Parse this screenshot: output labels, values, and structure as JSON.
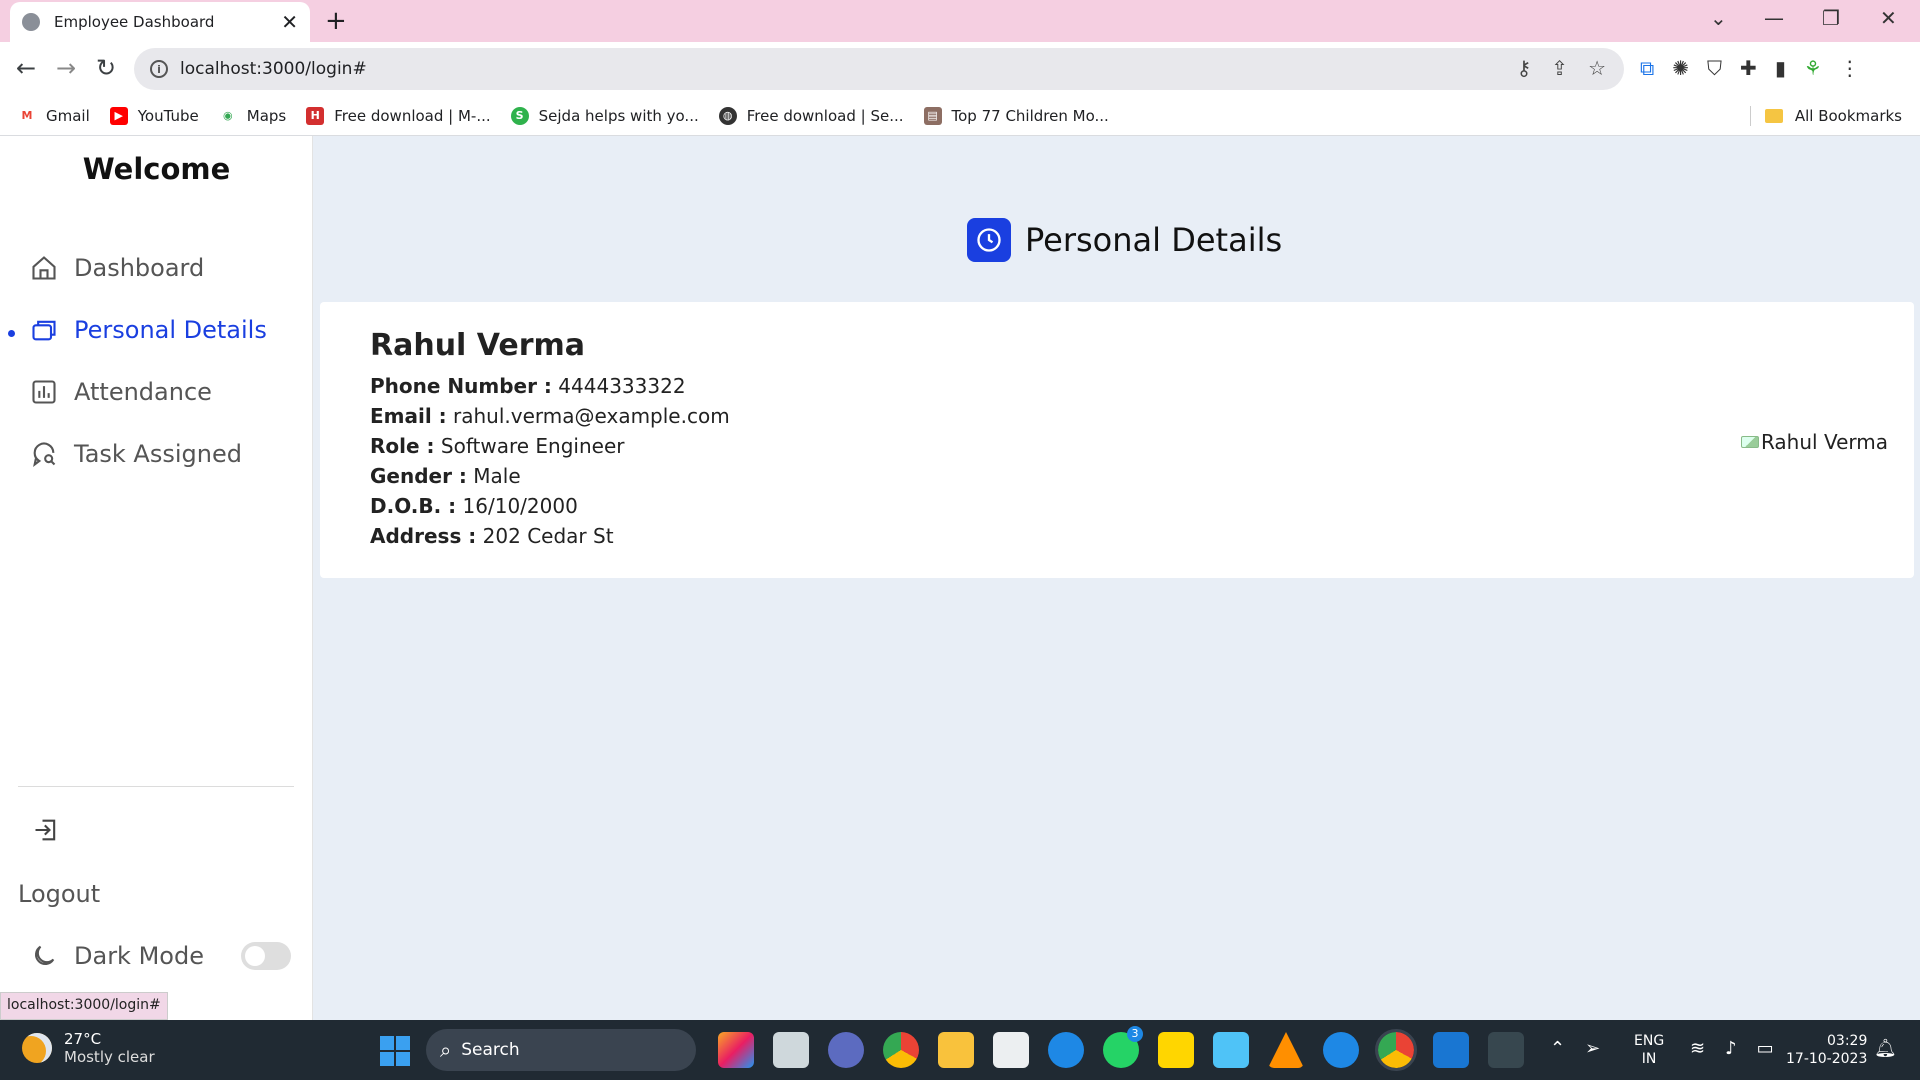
{
  "browser": {
    "tab_title": "Employee Dashboard",
    "url": "localhost:3000/login#",
    "bookmarks": [
      {
        "label": "Gmail",
        "color": "#ea4335",
        "glyph": "M"
      },
      {
        "label": "YouTube",
        "color": "#ff0000",
        "glyph": "▶"
      },
      {
        "label": "Maps",
        "color": "#34a853",
        "glyph": "◉"
      },
      {
        "label": "Free download | M-...",
        "color": "#d32f2f",
        "glyph": "H"
      },
      {
        "label": "Sejda helps with yo...",
        "color": "#2fb24c",
        "glyph": "S"
      },
      {
        "label": "Free download | Se...",
        "color": "#333333",
        "glyph": "◍"
      },
      {
        "label": "Top 77 Children Mo...",
        "color": "#8d6e63",
        "glyph": "▤"
      }
    ],
    "all_bookmarks": "All Bookmarks",
    "status_url": "localhost:3000/login#"
  },
  "sidebar": {
    "welcome": "Welcome",
    "items": [
      {
        "label": "Dashboard",
        "icon": "home-icon"
      },
      {
        "label": "Personal Details",
        "icon": "cards-icon"
      },
      {
        "label": "Attendance",
        "icon": "chart-icon"
      },
      {
        "label": "Task Assigned",
        "icon": "chat-search-icon"
      }
    ],
    "logout": "Logout",
    "dark_mode": "Dark Mode",
    "dark_mode_on": false
  },
  "page": {
    "title": "Personal Details",
    "accent": "#1a3fe0"
  },
  "employee": {
    "name": "Rahul Verma",
    "fields": [
      {
        "label": "Phone Number :",
        "value": " 4444333322"
      },
      {
        "label": "Email :",
        "value": " rahul.verma@example.com"
      },
      {
        "label": "Role :",
        "value": " Software Engineer"
      },
      {
        "label": "Gender :",
        "value": " Male"
      },
      {
        "label": "D.O.B. :",
        "value": " 16/10/2000"
      },
      {
        "label": "Address :",
        "value": " 202 Cedar St"
      }
    ],
    "photo_alt": "Rahul Verma"
  },
  "taskbar": {
    "temp": "27°C",
    "weather": "Mostly clear",
    "search": "Search",
    "lang1": "ENG",
    "lang2": "IN",
    "time": "03:29",
    "date": "17-10-2023",
    "whatsapp_badge": "3"
  }
}
